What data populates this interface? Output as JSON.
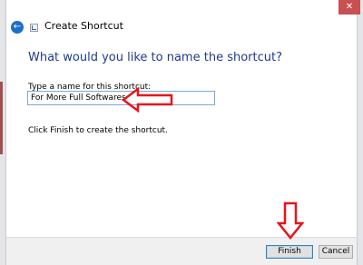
{
  "window": {
    "title": "Create Shortcut",
    "close_glyph": "✕",
    "back_glyph": "←"
  },
  "main": {
    "heading": "What would you like to name the shortcut?",
    "field_label": "Type a name for this shortcut:",
    "field_value": "For More Full Softwares",
    "hint": "Click Finish to create the shortcut."
  },
  "footer": {
    "finish_label": "Finish",
    "cancel_label": "Cancel"
  },
  "colors": {
    "accent": "#1c6fc8",
    "heading": "#1e3c8c",
    "annotation_arrow": "#e8141b",
    "close_button": "#c75050"
  },
  "icons": [
    "back-arrow-icon",
    "wizard-icon",
    "close-icon",
    "annotation-arrow-left-icon",
    "annotation-arrow-down-icon"
  ]
}
